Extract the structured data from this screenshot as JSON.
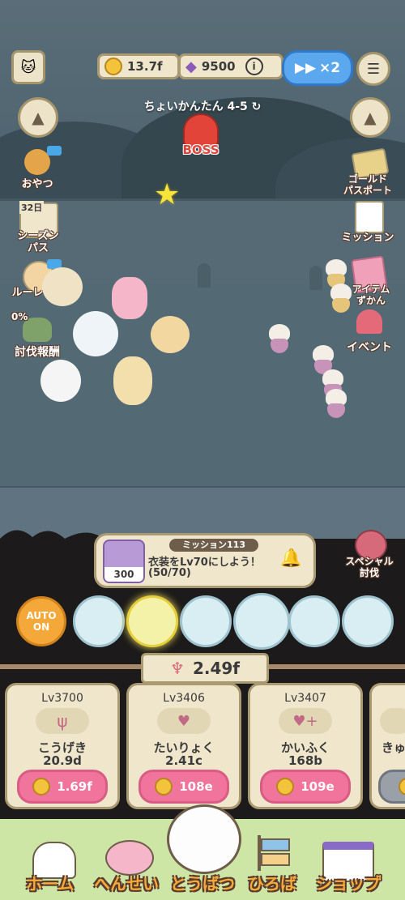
{
  "header": {
    "gold": "13.7f",
    "gems": "9500",
    "speed": "×2",
    "stage": "ちょいかんたん 4-5",
    "boss_label": "BOSS"
  },
  "left_menu": {
    "oyatsu": "おやつ",
    "season_days": "32日",
    "season_pass": "シーズン\nパス",
    "roulette": "ルーレット",
    "subjugation_pct": "0%",
    "subjugation_reward": "討伐報酬"
  },
  "right_menu": {
    "gold_pass": "ゴールド\nパスポート",
    "mission": "ミッション",
    "item_book": "アイテム\nずかん",
    "event": "イベント",
    "special_subjugation": "スペシャル\n討伐"
  },
  "mission": {
    "title": "ミッション113",
    "desc": "衣装をLv70にしよう！",
    "progress": "(50/70)",
    "reward": "300"
  },
  "auto_button": "AUTO\nON",
  "total_power": "2.49f",
  "upgrades": [
    {
      "lv": "Lv3700",
      "name": "こうげき",
      "value": "20.9d",
      "cost": "1.69f"
    },
    {
      "lv": "Lv3406",
      "name": "たいりょく",
      "value": "2.41c",
      "cost": "108e"
    },
    {
      "lv": "Lv3407",
      "name": "かいふく",
      "value": "168b",
      "cost": "109e"
    },
    {
      "name": "きゅ"
    }
  ],
  "nav": {
    "home": "ホーム",
    "formation": "へんせい",
    "battle": "とうばつ",
    "plaza": "ひろば",
    "shop": "ショップ"
  },
  "colors": {
    "accent_pink": "#f0749b",
    "panel_cream": "#efe6cc",
    "speed_blue": "#5ba8ee"
  }
}
